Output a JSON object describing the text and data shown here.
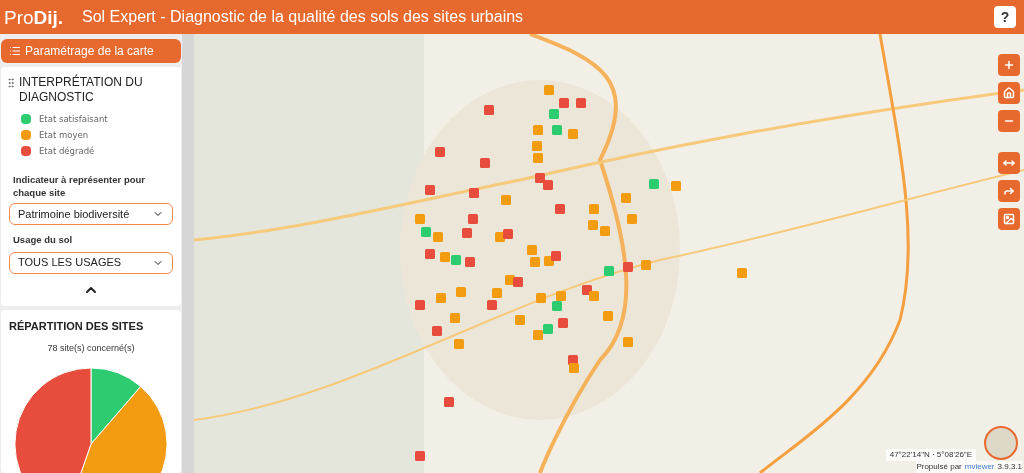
{
  "header": {
    "logo": {
      "part_1": "Pro",
      "part_2": "Dij."
    },
    "title": "Sol Expert - Diagnostic de la qualité des sols des sites urbains",
    "help_button": "?"
  },
  "sidebar": {
    "settings_button": "Paramétrage de la carte",
    "legend": {
      "title": "INTERPRÉTATION DU DIAGNOSTIC",
      "items": [
        {
          "label": "Etat satisfaisant",
          "color": "#2ecc71"
        },
        {
          "label": "Etat moyen",
          "color": "#f39c12"
        },
        {
          "label": "Etat dégradé",
          "color": "#e74c3c"
        }
      ]
    },
    "indicator": {
      "label": "Indicateur à représenter pour chaque site",
      "value": "Patrimoine biodiversité"
    },
    "usage": {
      "label": "Usage du sol",
      "value": "TOUS LES USAGES"
    },
    "distribution": {
      "title": "RÉPARTITION DES SITES",
      "count": "78 site(s) concerné(s)"
    }
  },
  "map": {
    "coordinates": "47°22'14\"N · 5°08'26\"E",
    "credit": {
      "text": "Propulsé par",
      "link": "mviewer",
      "version": "3.9.3.1"
    }
  }
}
